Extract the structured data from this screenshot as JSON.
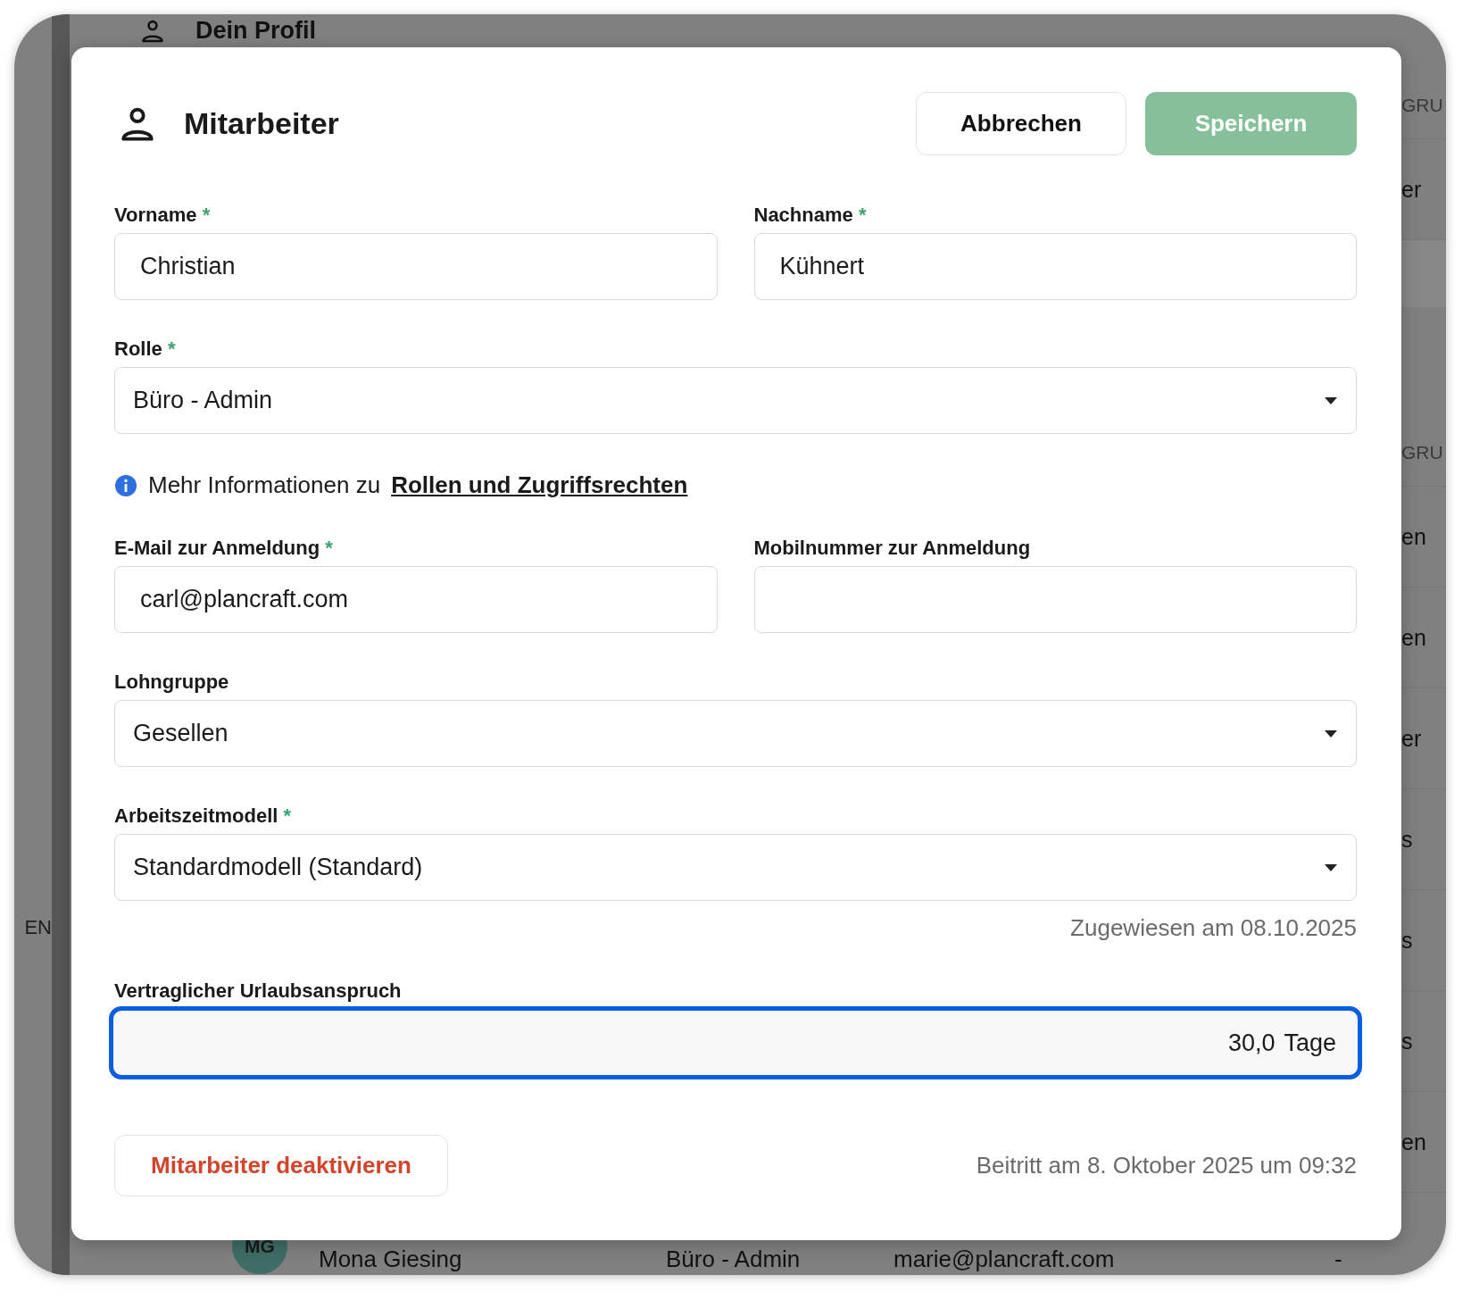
{
  "background": {
    "profile_link": "Dein Profil",
    "side_label": "EN",
    "right_column": [
      {
        "header": "GRU",
        "rows": [
          "er"
        ]
      },
      {
        "header": "GRU",
        "rows": [
          "en",
          "en",
          "er",
          "s",
          "s",
          "s",
          "en"
        ]
      }
    ],
    "table_row": {
      "initials": "MG",
      "name": "Mona Giesing",
      "role": "Büro - Admin",
      "email": "marie@plancraft.com",
      "column_5": "-"
    }
  },
  "dialog": {
    "title": "Mitarbeiter",
    "buttons": [
      {
        "label": "Abbrechen",
        "kind": "secondary"
      },
      {
        "label": "Speichern",
        "kind": "primary"
      }
    ],
    "form": [
      {
        "kind": "pair",
        "fields": [
          {
            "label": "Vorname",
            "marker": "*",
            "value": "Christian"
          },
          {
            "label": "Nachname",
            "marker": "*",
            "value": "Kühnert"
          }
        ]
      },
      {
        "kind": "select",
        "label": "Rolle",
        "marker": "*",
        "value": "Büro - Admin"
      },
      {
        "kind": "info",
        "text": "Mehr Informationen zu",
        "link": "Rollen und Zugriffsrechten"
      },
      {
        "kind": "pair",
        "fields": [
          {
            "label": "E-Mail zur Anmeldung",
            "marker": "*",
            "value": "carl@plancraft.com"
          },
          {
            "label": "Mobilnummer zur Anmeldung"
          }
        ]
      },
      {
        "kind": "select",
        "label": "Lohngruppe",
        "value": "Gesellen"
      },
      {
        "kind": "select",
        "label": "Arbeitszeitmodell",
        "marker": "*",
        "value": "Standardmodell (Standard)",
        "note": "Zugewiesen am 08.10.2025"
      },
      {
        "kind": "number",
        "label": "Vertraglicher Urlaubsanspruch",
        "value": "30,0",
        "unit": "Tage",
        "focused": true
      }
    ],
    "footer": {
      "deactivate": "Mitarbeiter deaktivieren",
      "joined": "Beitritt am 8. Oktober 2025 um 09:32"
    }
  }
}
